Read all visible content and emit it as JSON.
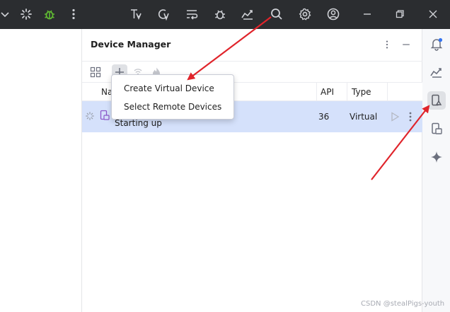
{
  "device_manager": {
    "title": "Device Manager",
    "columns": {
      "name": "Na",
      "api": "API",
      "type": "Type"
    },
    "devices": [
      {
        "status": "Starting up",
        "api": "36",
        "type": "Virtual"
      }
    ]
  },
  "add_menu": {
    "items": [
      "Create Virtual Device",
      "Select Remote Devices"
    ]
  },
  "watermark": "CSDN @stealPigs-youth",
  "colors": {
    "titlebar": "#2b2d30",
    "selected_row": "#d5e1fb",
    "arrow": "#e0242b",
    "debug": "#5fb832",
    "notification_dot": "#3574f0"
  }
}
